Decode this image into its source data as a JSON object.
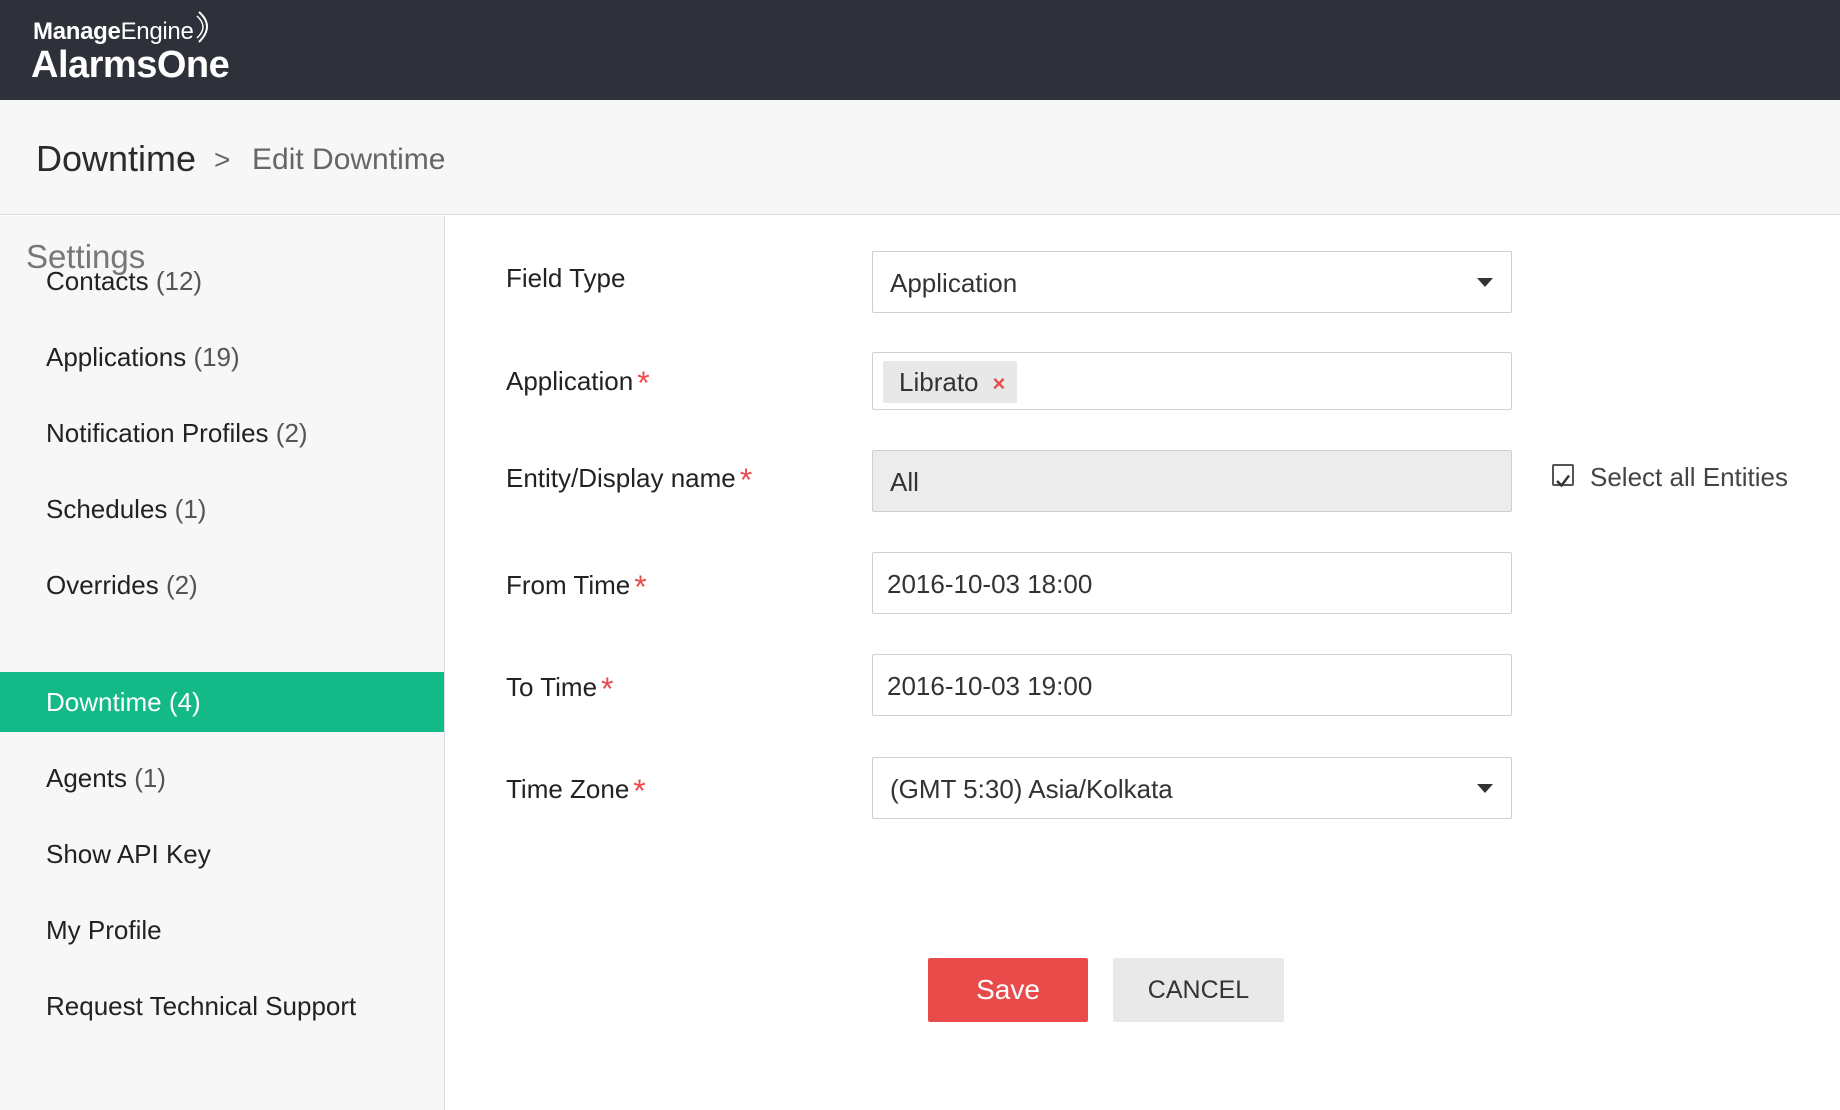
{
  "brand": {
    "company_bold": "Manage",
    "company_light": "Engine",
    "product": "AlarmsOne"
  },
  "breadcrumb": {
    "root": "Downtime",
    "separator": ">",
    "current": "Edit Downtime"
  },
  "sidebar": {
    "heading": "Settings",
    "items": [
      {
        "label": "Contacts",
        "count": "(12)"
      },
      {
        "label": "Applications",
        "count": "(19)"
      },
      {
        "label": "Notification Profiles",
        "count": "(2)"
      },
      {
        "label": "Schedules",
        "count": "(1)"
      },
      {
        "label": "Overrides",
        "count": "(2)"
      },
      {
        "label": "Downtime",
        "count": "(4)"
      },
      {
        "label": "Agents",
        "count": "(1)"
      },
      {
        "label": "Show API Key",
        "count": ""
      },
      {
        "label": "My Profile",
        "count": ""
      },
      {
        "label": "Request Technical Support",
        "count": ""
      }
    ],
    "active_index": 5,
    "active_color": "#13b986"
  },
  "form": {
    "field_type": {
      "label": "Field Type",
      "value": "Application"
    },
    "application": {
      "label": "Application",
      "required_mark": "*",
      "chip": "Librato",
      "chip_remove": "×"
    },
    "entity": {
      "label": "Entity/Display name",
      "required_mark": "*",
      "value": "All"
    },
    "select_all": {
      "label": "Select all Entities",
      "checked": true
    },
    "from_time": {
      "label": "From Time",
      "required_mark": "*",
      "value": "2016-10-03 18:00"
    },
    "to_time": {
      "label": "To Time",
      "required_mark": "*",
      "value": "2016-10-03 19:00"
    },
    "time_zone": {
      "label": "Time Zone",
      "required_mark": "*",
      "value": "(GMT 5:30) Asia/Kolkata"
    }
  },
  "actions": {
    "save": "Save",
    "cancel": "CANCEL",
    "save_color": "#e94b4b"
  }
}
